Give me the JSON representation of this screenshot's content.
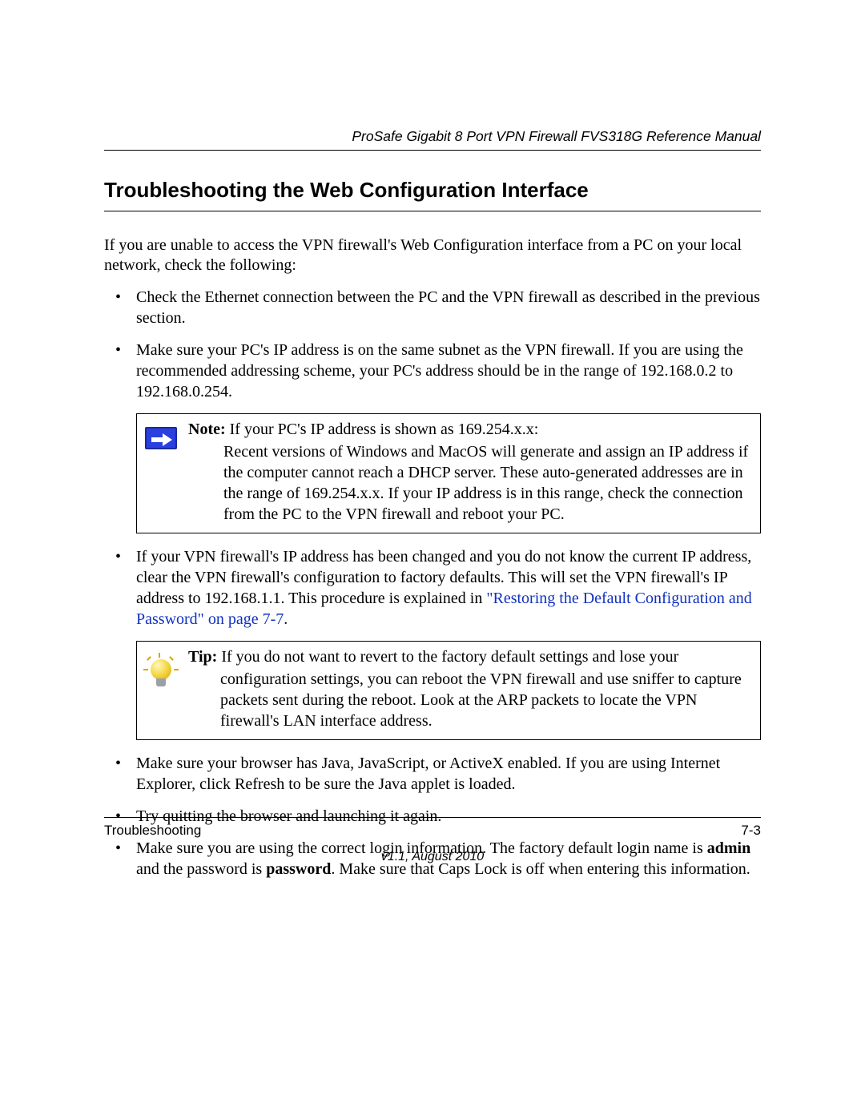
{
  "header": {
    "running_title": "ProSafe Gigabit 8 Port VPN Firewall FVS318G Reference Manual"
  },
  "section": {
    "title": "Troubleshooting the Web Configuration Interface",
    "intro": "If you are unable to access the VPN firewall's Web Configuration interface from a PC on your local network, check the following:"
  },
  "bullets": {
    "b1": "Check the Ethernet connection between the PC and the VPN firewall as described in the previous section.",
    "b2": "Make sure your PC's IP address is on the same subnet as the VPN firewall. If you are using the recommended addressing scheme, your PC's address should be in the range of 192.168.0.2 to 192.168.0.254.",
    "b3_pre": "If your VPN firewall's IP address has been changed and you do not know the current IP address, clear the VPN firewall's configuration to factory defaults. This will set the VPN firewall's IP address to 192.168.1.1. This procedure is explained in ",
    "b3_link": "\"Restoring the Default Configuration and Password\" on page 7-7",
    "b3_post": ".",
    "b4": "Make sure your browser has Java, JavaScript, or ActiveX enabled. If you are using Internet Explorer, click Refresh to be sure the Java applet is loaded.",
    "b5": "Try quitting the browser and launching it again.",
    "b6_pre": "Make sure you are using the correct login information. The factory default login name is ",
    "b6_admin": "admin",
    "b6_mid": " and the password is ",
    "b6_password": "password",
    "b6_post": ". Make sure that Caps Lock is off when entering this information."
  },
  "note": {
    "label": "Note:",
    "lead": " If your PC's IP address is shown as 169.254.x.x:",
    "body": "Recent versions of Windows and MacOS will generate and assign an IP address if the computer cannot reach a DHCP server. These auto-generated addresses are in the range of 169.254.x.x. If your IP address is in this range, check the connection from the PC to the VPN firewall and reboot your PC."
  },
  "tip": {
    "label": "Tip:",
    "lead": " If you do not want to revert to the factory default settings and lose your",
    "body": "configuration settings, you can reboot the VPN firewall and use sniffer to capture packets sent during the reboot. Look at the ARP packets to locate the VPN firewall's LAN interface address."
  },
  "footer": {
    "chapter": "Troubleshooting",
    "page": "7-3",
    "version": "v1.1, August 2010"
  }
}
